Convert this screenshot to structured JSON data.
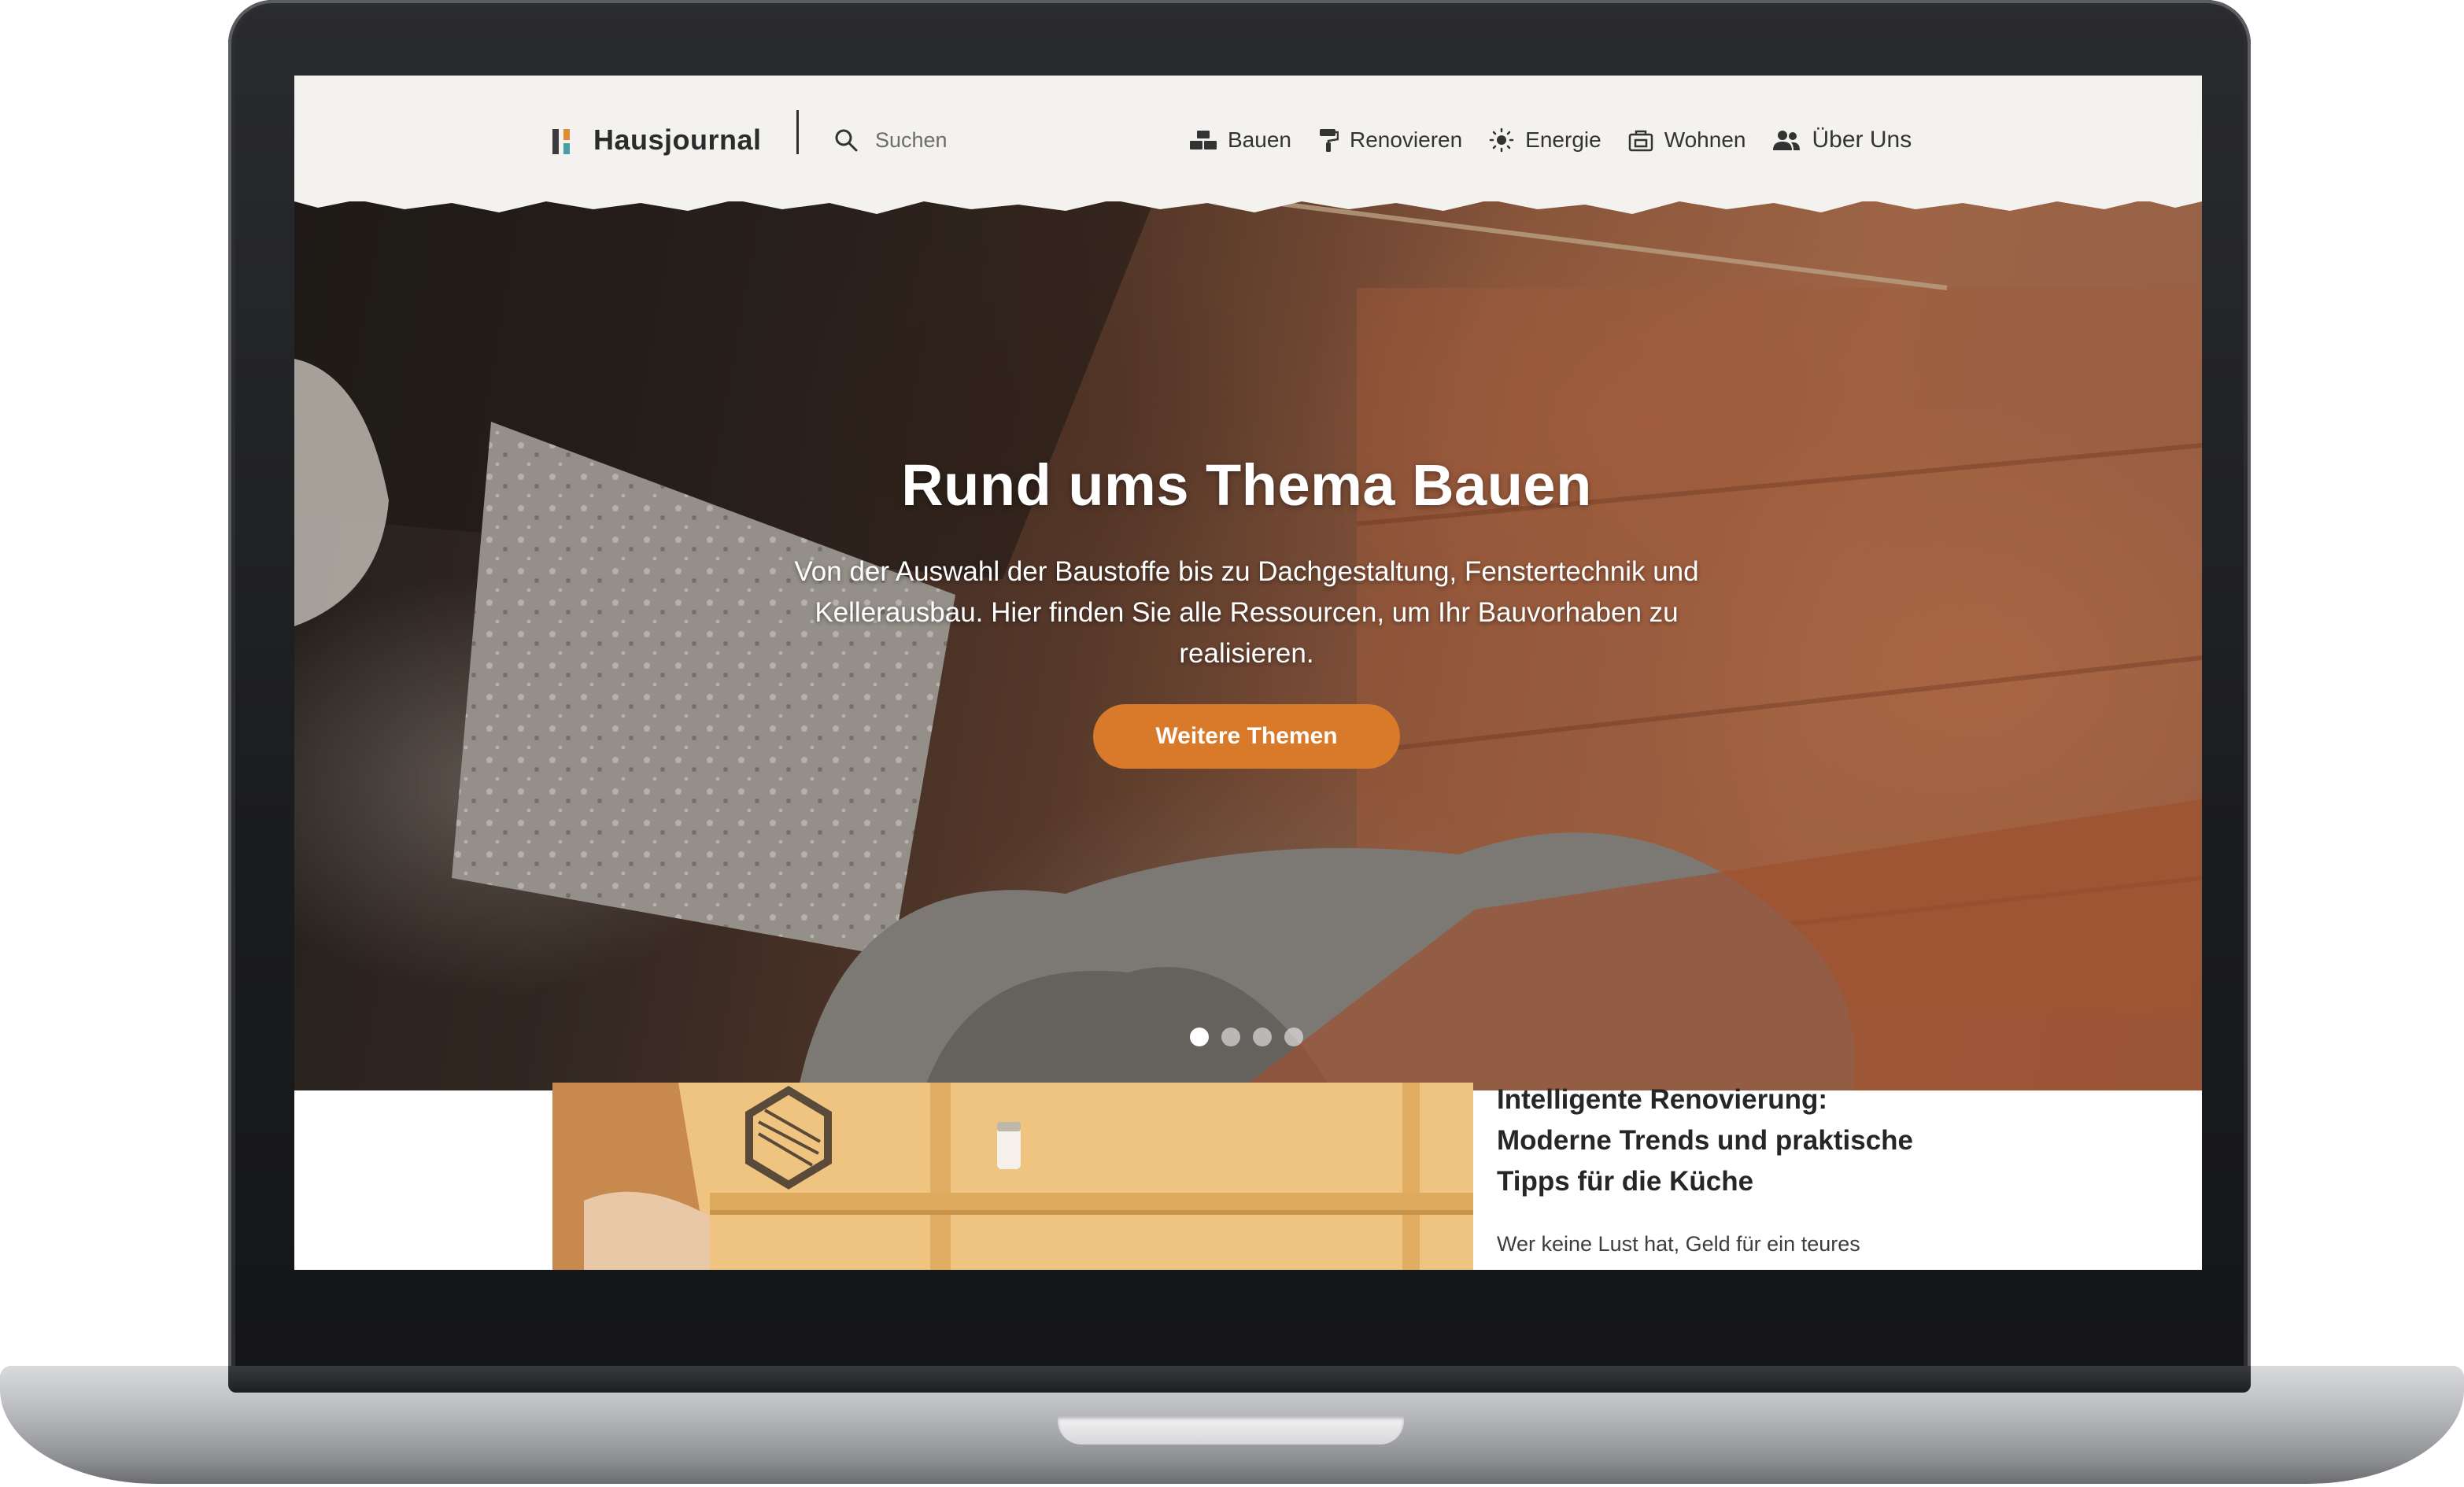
{
  "header": {
    "brand": "Hausjournal",
    "search_label": "Suchen",
    "nav": [
      {
        "label": "Bauen",
        "icon": "bricks-icon"
      },
      {
        "label": "Renovieren",
        "icon": "paint-roller-icon"
      },
      {
        "label": "Energie",
        "icon": "sun-icon"
      },
      {
        "label": "Wohnen",
        "icon": "house-icon"
      },
      {
        "label": "Über Uns",
        "icon": "people-icon"
      }
    ]
  },
  "hero": {
    "title": "Rund ums Thema Bauen",
    "text": "Von der Auswahl der Baustoffe bis zu Dachgestaltung, Fenstertechnik und Kellerausbau. Hier finden Sie alle Ressourcen, um Ihr Bauvorhaben zu realisieren.",
    "button": "Weitere Themen",
    "slides_total": 4,
    "active_slide": 1
  },
  "article": {
    "title": "Intelligente Renovierung: Moderne Trends und praktische Tipps für die Küche",
    "excerpt": "Wer keine Lust hat, Geld für ein teures"
  },
  "colors": {
    "header_bg": "#f4f2ee",
    "accent": "#d97a2b",
    "brand_bars": [
      "#3c3c3c",
      "#e08a34",
      "#4a9ea3"
    ]
  }
}
